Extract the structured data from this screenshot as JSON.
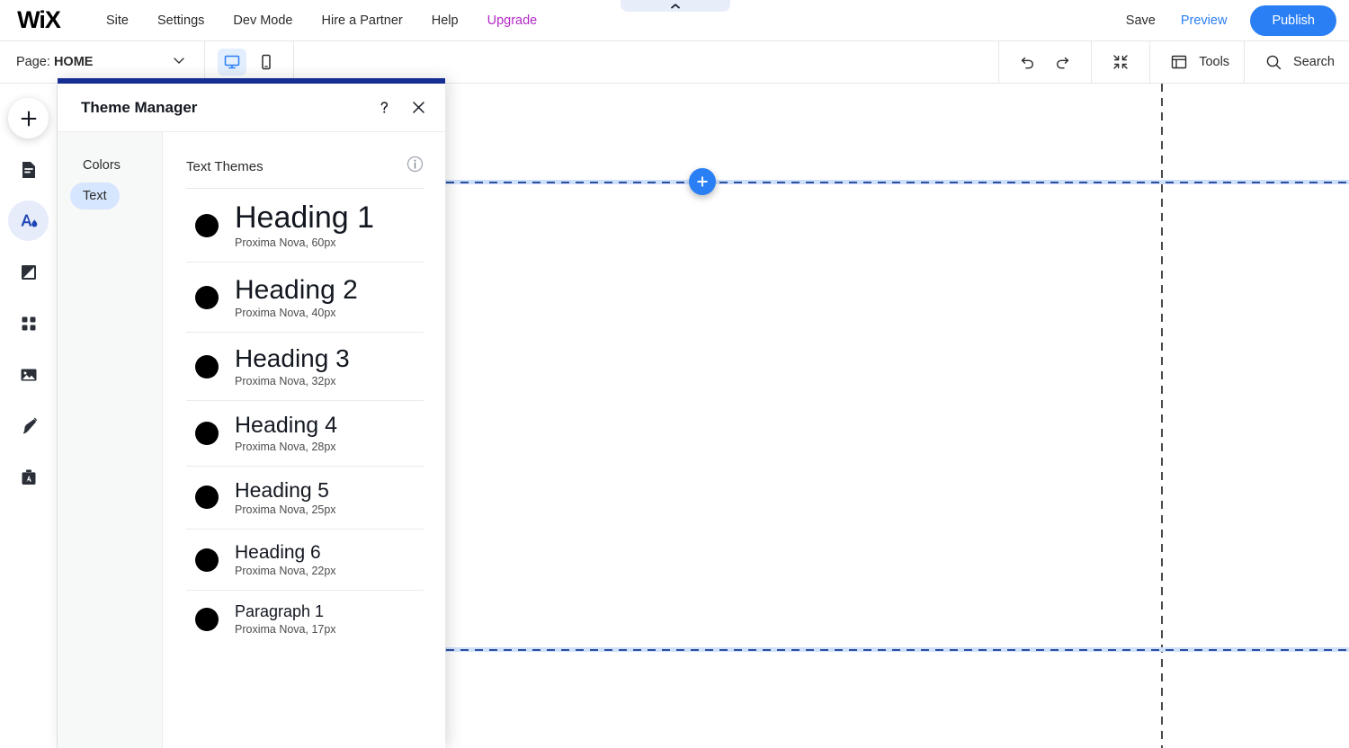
{
  "topbar": {
    "logo": "WiX",
    "nav": [
      {
        "label": "Site",
        "name": "topnav-site"
      },
      {
        "label": "Settings",
        "name": "topnav-settings"
      },
      {
        "label": "Dev Mode",
        "name": "topnav-dev-mode"
      },
      {
        "label": "Hire a Partner",
        "name": "topnav-hire-a-partner"
      },
      {
        "label": "Help",
        "name": "topnav-help"
      },
      {
        "label": "Upgrade",
        "name": "topnav-upgrade"
      }
    ],
    "save_label": "Save",
    "preview_label": "Preview",
    "publish_label": "Publish",
    "accent_blue": "#2b7ff5",
    "upgrade_color": "#b429c8"
  },
  "toolbar": {
    "page_prefix": "Page:",
    "page_name": "HOME",
    "devices": [
      {
        "name": "desktop-view-button",
        "icon": "desktop-icon",
        "active": true
      },
      {
        "name": "mobile-view-button",
        "icon": "mobile-icon",
        "active": false
      }
    ],
    "undo_icon": "undo-icon",
    "redo_icon": "redo-icon",
    "zoom_out_icon": "zoom-out-icon",
    "tools_label": "Tools",
    "search_label": "Search"
  },
  "rail": {
    "items": [
      {
        "name": "add-elements-button",
        "icon": "plus-icon"
      },
      {
        "name": "pages-menu-button",
        "icon": "page-icon"
      },
      {
        "name": "theme-manager-button",
        "icon": "theme-icon",
        "active": true
      },
      {
        "name": "background-button",
        "icon": "background-icon"
      },
      {
        "name": "apps-button",
        "icon": "apps-grid-icon"
      },
      {
        "name": "media-button",
        "icon": "image-icon"
      },
      {
        "name": "blog-button",
        "icon": "pen-icon"
      },
      {
        "name": "business-tools-button",
        "icon": "briefcase-a-icon"
      }
    ]
  },
  "canvas": {
    "collapse_tab_icon": "chevron-up-icon",
    "add_section_icon": "plus-icon",
    "guide_color": "#2b4f9e",
    "guide_glow": "#cfe0fb",
    "vertical_guide_color": "#4a4a4a"
  },
  "panel": {
    "title": "Theme Manager",
    "help_icon": "question-mark-icon",
    "close_icon": "close-icon",
    "accent_color": "#162d91",
    "nav": [
      {
        "label": "Colors",
        "name": "panel-nav-colors",
        "active": false
      },
      {
        "label": "Text",
        "name": "panel-nav-text",
        "active": true
      }
    ],
    "section_title": "Text Themes",
    "info_icon": "info-icon",
    "themes": [
      {
        "sample": "Heading 1",
        "meta": "Proxima Nova, 60px",
        "size": 34,
        "swatch": "#000000"
      },
      {
        "sample": "Heading 2",
        "meta": "Proxima Nova, 40px",
        "size": 30,
        "swatch": "#000000"
      },
      {
        "sample": "Heading 3",
        "meta": "Proxima Nova, 32px",
        "size": 28,
        "swatch": "#000000"
      },
      {
        "sample": "Heading 4",
        "meta": "Proxima Nova, 28px",
        "size": 25,
        "swatch": "#000000"
      },
      {
        "sample": "Heading 5",
        "meta": "Proxima Nova, 25px",
        "size": 23,
        "swatch": "#000000"
      },
      {
        "sample": "Heading 6",
        "meta": "Proxima Nova, 22px",
        "size": 21,
        "swatch": "#000000"
      },
      {
        "sample": "Paragraph 1",
        "meta": "Proxima Nova, 17px",
        "size": 18,
        "swatch": "#000000"
      }
    ]
  }
}
